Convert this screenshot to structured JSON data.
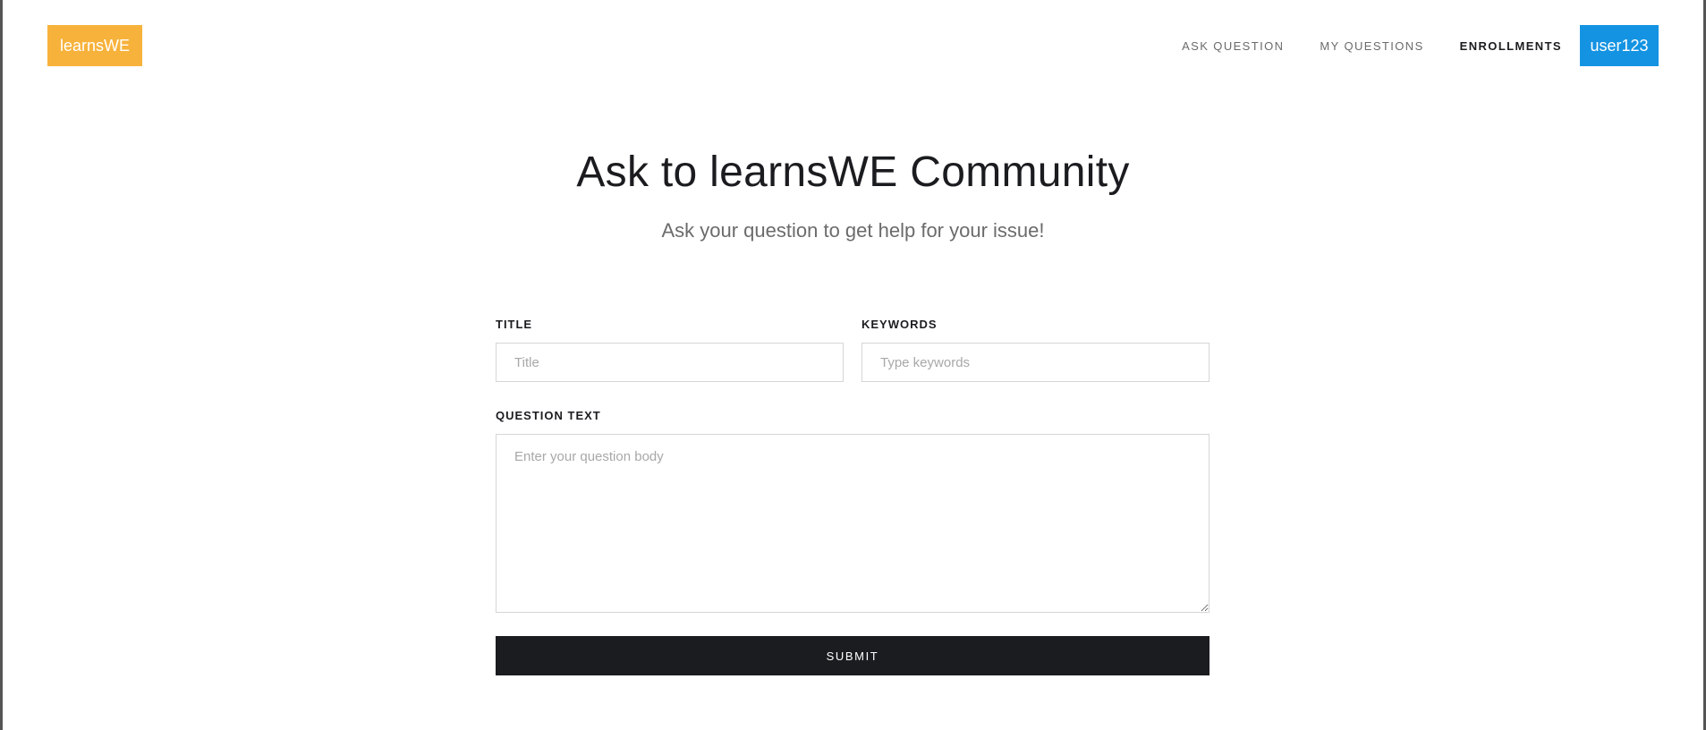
{
  "header": {
    "logo_text": "learnsWE",
    "nav": [
      {
        "label": "ASK QUESTION"
      },
      {
        "label": "MY QUESTIONS"
      },
      {
        "label": "ENROLLMENTS"
      }
    ],
    "user_label": "user123"
  },
  "hero": {
    "title": "Ask to learnsWE Community",
    "subtitle": "Ask your question to get help for your issue!"
  },
  "form": {
    "title_label": "TITLE",
    "title_placeholder": "Title",
    "title_value": "",
    "keywords_label": "KEYWORDS",
    "keywords_placeholder": "Type keywords",
    "keywords_value": "",
    "question_label": "QUESTION TEXT",
    "question_placeholder": "Enter your question body",
    "question_value": "",
    "submit_label": "SUBMIT"
  },
  "colors": {
    "logo_bg": "#f7b23b",
    "user_bg": "#1493e2",
    "submit_bg": "#1b1c1f"
  }
}
